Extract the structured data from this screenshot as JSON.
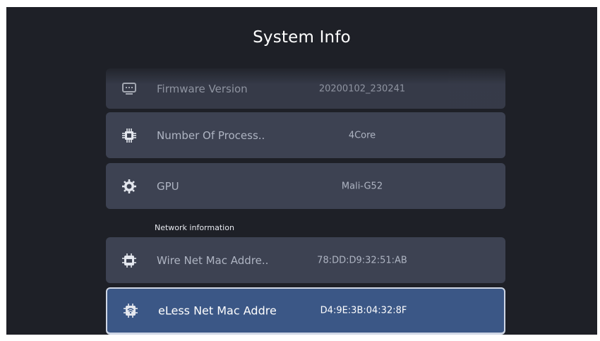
{
  "title": "System Info",
  "rows": [
    {
      "icon": "monitor-icon",
      "label": "Firmware Version",
      "value": "20200102_230241"
    },
    {
      "icon": "cpu-chip-icon",
      "label": "Number Of Process..",
      "value": "4Core"
    },
    {
      "icon": "gear-chip-icon",
      "label": "GPU",
      "value": "Mali-G52"
    }
  ],
  "network": {
    "heading": "Network information",
    "rows": [
      {
        "icon": "ethernet-chip-icon",
        "label": "Wire Net Mac Addre..",
        "value": "78:DD:D9:32:51:AB"
      },
      {
        "icon": "wifi-chip-icon",
        "label": "eLess Net Mac Addre",
        "value": "D4:9E:3B:04:32:8F"
      }
    ]
  },
  "colors": {
    "background": "#1e2027",
    "row": "#3d4252",
    "selected_row": "#3b5786",
    "text": "#aeb4c2"
  }
}
